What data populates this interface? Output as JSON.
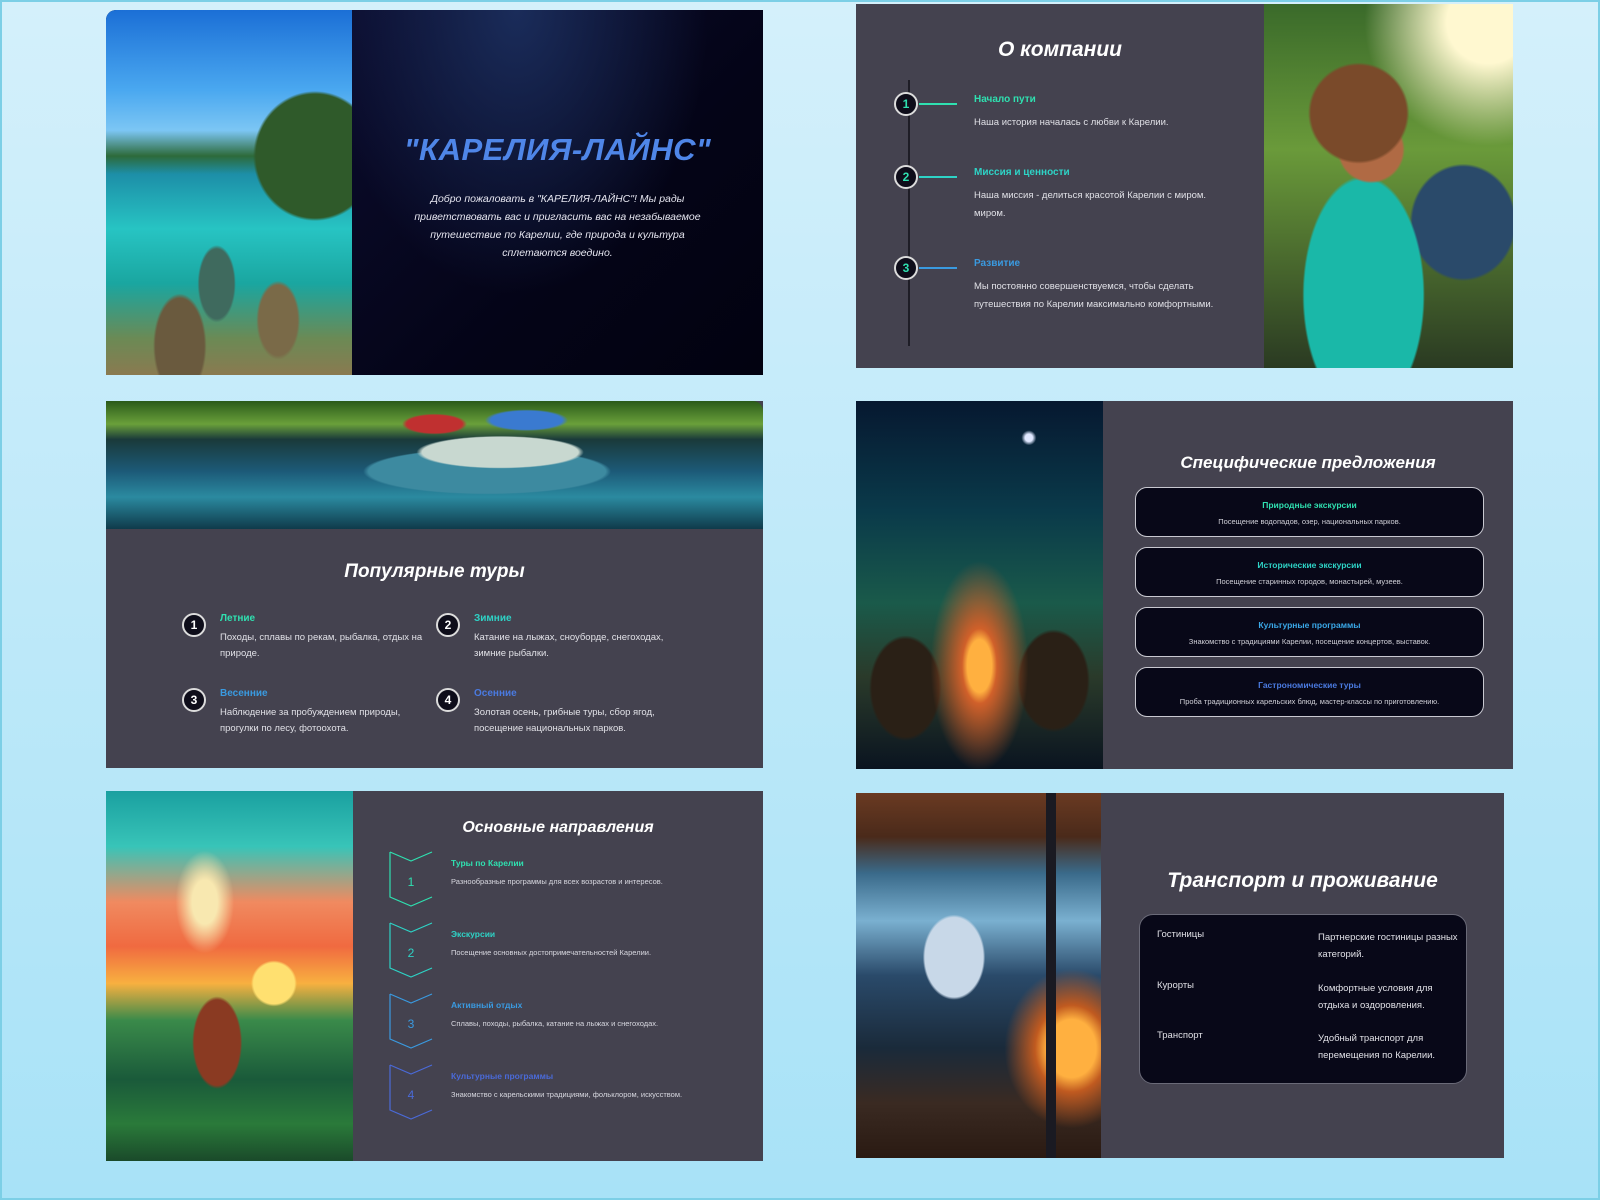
{
  "colors": {
    "background": "#bfe9f8",
    "slide": "#44424f",
    "green_accent": "#2fe0b0",
    "teal_accent": "#2ed3c6",
    "blue_accent": "#4a8be0",
    "title_blue": "#4f86e8"
  },
  "slide1": {
    "title": "\"КАРЕЛИЯ-ЛАЙНС\"",
    "description": "Добро пожаловать в \"КАРЕЛИЯ-ЛАЙНС\"! Мы рады приветствовать вас и пригласить вас на незабываемое путешествие по Карелии, где природа и культура сплетаются воедино."
  },
  "slide2": {
    "title": "О компании",
    "items": [
      {
        "number": "1",
        "heading": "Начало пути",
        "text": "Наша история началась с любви к Карелии.",
        "color": "#2fe0b0"
      },
      {
        "number": "2",
        "heading": "Миссия и ценности",
        "text": "Наша миссия - делиться красотой Карелии с миром. миром.",
        "color": "#2ed3c6"
      },
      {
        "number": "3",
        "heading": "Развитие",
        "text": "Мы постоянно совершенствуемся, чтобы сделать путешествия по Карелии максимально комфортными.",
        "color": "#3a9ae0"
      }
    ]
  },
  "slide3": {
    "title": "Популярные туры",
    "tours": [
      {
        "number": "1",
        "heading": "Летние",
        "text": "Походы, сплавы по рекам, рыбалка, отдых на природе.",
        "color": "#2fe0b0"
      },
      {
        "number": "2",
        "heading": "Зимние",
        "text": "Катание на лыжах, сноуборде, снегоходах, зимние рыбалки.",
        "color": "#2ed3c6"
      },
      {
        "number": "3",
        "heading": "Весенние",
        "text": "Наблюдение за пробуждением природы, прогулки по лесу, фотоохота.",
        "color": "#3a9ae0"
      },
      {
        "number": "4",
        "heading": "Осенние",
        "text": "Золотая осень, грибные туры, сбор ягод, посещение национальных парков.",
        "color": "#4a7ae0"
      }
    ]
  },
  "slide4": {
    "title": "Специфические предложения",
    "offers": [
      {
        "heading": "Природные экскурсии",
        "text": "Посещение водопадов, озер, национальных парков.",
        "color": "#2fe0b0"
      },
      {
        "heading": "Исторические экскурсии",
        "text": "Посещение старинных городов, монастырей, музеев.",
        "color": "#2ed3c6"
      },
      {
        "heading": "Культурные программы",
        "text": "Знакомство с традициями Карелии, посещение концертов, выставок.",
        "color": "#3aa8e8"
      },
      {
        "heading": "Гастрономические туры",
        "text": "Проба традиционных карельских блюд, мастер-классы по приготовлению.",
        "color": "#4a7ae0"
      }
    ]
  },
  "slide5": {
    "title": "Основные направления",
    "directions": [
      {
        "number": "1",
        "heading": "Туры по Карелии",
        "text": "Разнообразные программы для всех возрастов и интересов.",
        "color": "#2fe0b0"
      },
      {
        "number": "2",
        "heading": "Экскурсии",
        "text": "Посещение основных достопримечательностей Карелии.",
        "color": "#2ed3c6"
      },
      {
        "number": "3",
        "heading": "Активный отдых",
        "text": "Сплавы, походы, рыбалка, катание на лыжах и снегоходах.",
        "color": "#3a9ae0"
      },
      {
        "number": "4",
        "heading": "Культурные программы",
        "text": "Знакомство с карельскими традициями, фольклором, искусством.",
        "color": "#4a6ad8"
      }
    ]
  },
  "slide6": {
    "title": "Транспорт и проживание",
    "rows": [
      {
        "key": "Гостиницы",
        "value": "Партнерские гостиницы разных категорий."
      },
      {
        "key": "Курорты",
        "value": "Комфортные условия для отдыха и оздоровления."
      },
      {
        "key": "Транспорт",
        "value": "Удобный транспорт для перемещения по Карелии."
      }
    ]
  }
}
